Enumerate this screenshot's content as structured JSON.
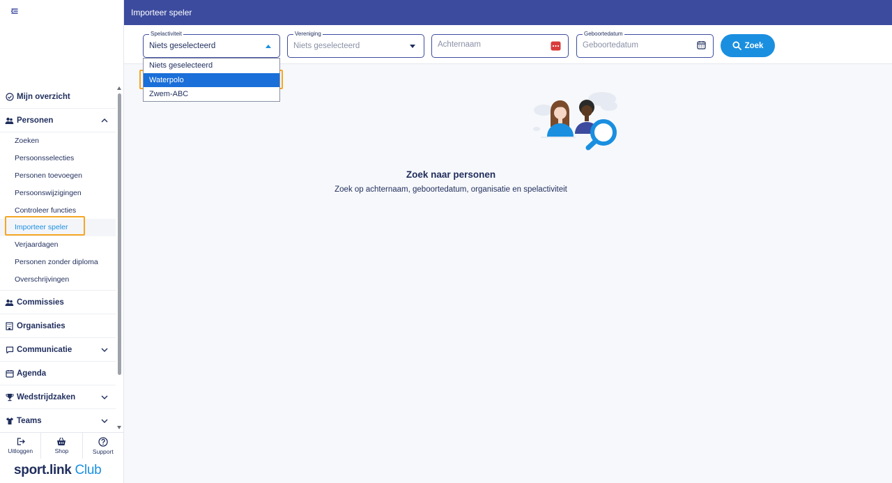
{
  "header": {
    "title": "Importeer speler"
  },
  "sidebar": {
    "sections": [
      {
        "label": "Mijn overzicht"
      },
      {
        "label": "Personen"
      },
      {
        "label": "Commissies"
      },
      {
        "label": "Organisaties"
      },
      {
        "label": "Communicatie"
      },
      {
        "label": "Agenda"
      },
      {
        "label": "Wedstrijdzaken"
      },
      {
        "label": "Teams"
      }
    ],
    "personen_items": [
      "Zoeken",
      "Persoonsselecties",
      "Personen toevoegen",
      "Persoonswijzigingen",
      "Controleer functies",
      "Importeer speler",
      "Verjaardagen",
      "Personen zonder diploma",
      "Overschrijvingen"
    ],
    "bottom": {
      "logout": "Uitloggen",
      "shop": "Shop",
      "support": "Support"
    },
    "logo": {
      "sport": "sport",
      "dot": ".",
      "link": "link",
      "club": " Club"
    }
  },
  "filters": {
    "spelactiviteit": {
      "label": "Spelactiviteit",
      "value": "Niets geselecteerd"
    },
    "vereniging": {
      "label": "Vereniging",
      "placeholder": "Niets geselecteerd"
    },
    "achternaam": {
      "placeholder": "Achternaam"
    },
    "geboortedatum": {
      "label": "Geboortedatum",
      "placeholder": "Geboortedatum"
    },
    "search_button": "Zoek"
  },
  "dropdown": {
    "options": [
      "Niets geselecteerd",
      "Waterpolo",
      "Zwem-ABC"
    ],
    "highlighted": "Waterpolo"
  },
  "empty_state": {
    "title": "Zoek naar personen",
    "subtitle": "Zoek op achternaam, geboortedatum, organisatie en spelactiviteit"
  },
  "colors": {
    "header_bg": "#3c4b9e",
    "accent": "#1a8fe0",
    "selected_option": "#1a6fd9",
    "highlight": "#f5a623"
  }
}
